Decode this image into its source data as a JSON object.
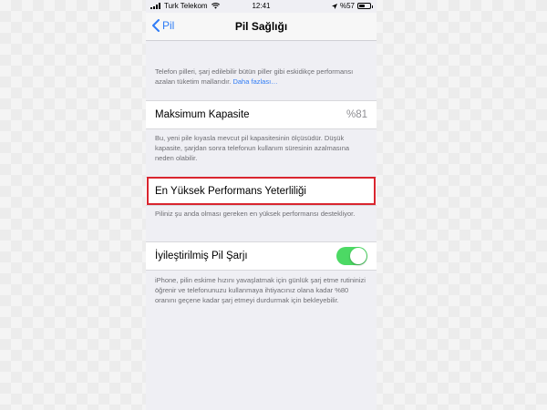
{
  "status_bar": {
    "carrier": "Turk Telekom",
    "time": "12:41",
    "battery_percent": "%57",
    "battery_level": 0.57
  },
  "nav": {
    "back_label": "Pil",
    "title": "Pil Sağlığı"
  },
  "intro": {
    "text": "Telefon pilleri, şarj edilebilir bütün piller gibi eskidikçe performansı azalan tüketim mallarıdır.",
    "link": "Daha fazlası…"
  },
  "max_capacity": {
    "label": "Maksimum Kapasite",
    "value": "%81",
    "footer": "Bu, yeni pile kıyasla mevcut pil kapasitesinin ölçüsüdür. Düşük kapasite, şarjdan sonra telefonun kullanım süresinin azalmasına neden olabilir."
  },
  "peak_performance": {
    "label": "En Yüksek Performans Yeterliliği",
    "footer": "Piliniz şu anda olması gereken en yüksek performansı destekliyor."
  },
  "optimized_charging": {
    "label": "İyileştirilmiş Pil Şarjı",
    "enabled": true,
    "footer": "iPhone, pilin eskime hızını yavaşlatmak için günlük şarj etme rutininizi öğrenir ve telefonunuzu kullanmaya ihtiyacınız olana kadar %80 oranını geçene kadar şarj etmeyi durdurmak için bekleyebilir."
  },
  "colors": {
    "accent": "#2f7cf6",
    "toggle_on": "#4cd964",
    "highlight": "#d9252f"
  }
}
